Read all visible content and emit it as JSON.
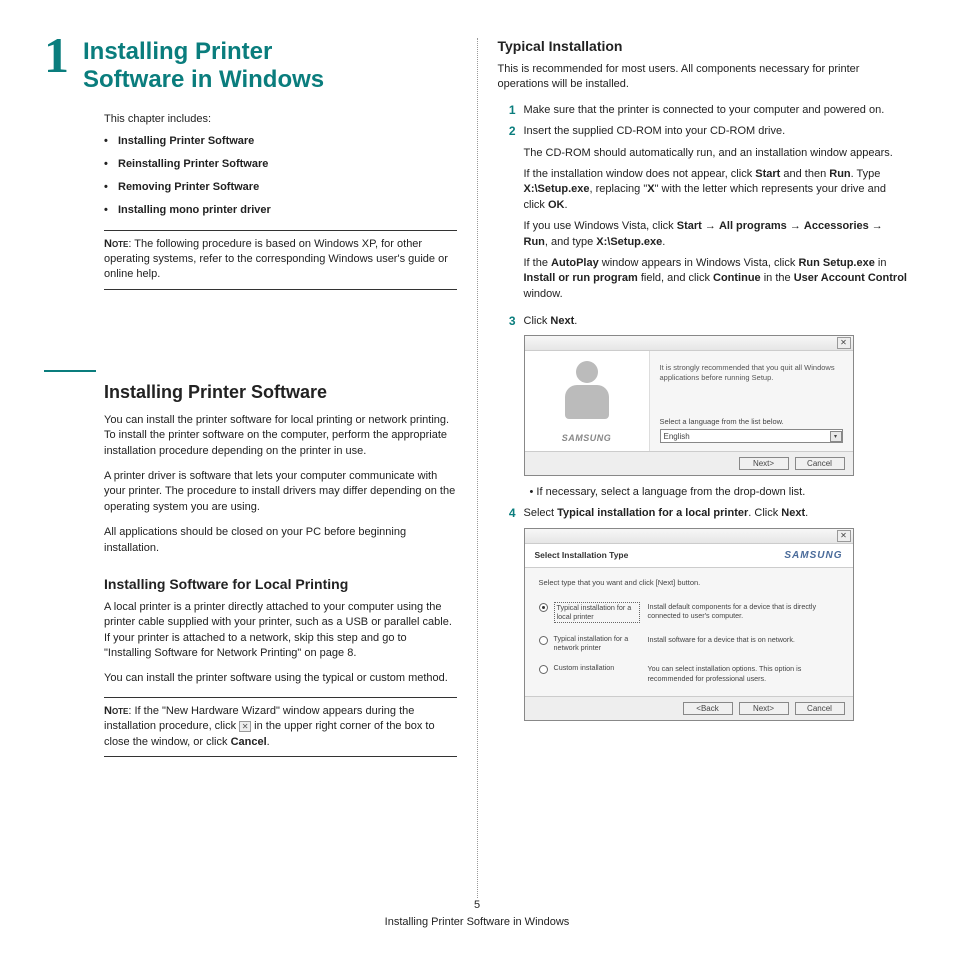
{
  "chapter": {
    "number": "1",
    "title_l1": "Installing Printer",
    "title_l2": "Software in Windows"
  },
  "left": {
    "this_chapter": "This chapter includes:",
    "bullets": [
      "Installing Printer Software",
      "Reinstalling Printer Software",
      "Removing Printer Software",
      "Installing mono printer driver"
    ],
    "note1_label": "Note",
    "note1_text": ": The following procedure is based on Windows XP, for other operating systems, refer to the corresponding Windows user's guide or online help.",
    "h2": "Installing Printer Software",
    "p1": "You can install the printer software for local printing or network printing. To install the printer software on the computer, perform the appropriate installation procedure depending on the printer in use.",
    "p2": "A printer driver is software that lets your computer communicate with your printer. The procedure to install drivers may differ depending on the operating system you are using.",
    "p3": "All applications should be closed on your PC before beginning installation.",
    "h3": "Installing Software for Local Printing",
    "p4": "A local printer is a printer directly attached to your computer using the printer cable supplied with your printer, such as a USB or parallel cable. If your printer is attached to a network, skip this step and go to \"Installing Software for Network Printing\" on page 8.",
    "p5": "You can install the printer software using the typical or custom method.",
    "note2_label": "Note",
    "note2_pre": ": If the \"New Hardware Wizard\" window appears during the installation procedure, click ",
    "note2_post": " in the upper right corner of the box to close the window, or click ",
    "note2_cancel": "Cancel",
    "note2_end": "."
  },
  "right": {
    "h3": "Typical Installation",
    "intro": "This is recommended for most users. All components necessary for printer operations will be installed.",
    "step1": "Make sure that the printer is connected to your computer and powered on.",
    "step2_a": "Insert the supplied CD-ROM into your CD-ROM drive.",
    "step2_b": "The CD-ROM should automatically run, and an installation window appears.",
    "step2_c_pre": "If the installation window does not appear, click ",
    "step2_c_start": "Start",
    "step2_c_mid1": " and then ",
    "step2_c_run": "Run",
    "step2_c_mid2": ". Type ",
    "step2_c_setup": "X:\\Setup.exe",
    "step2_c_mid3": ", replacing \"",
    "step2_c_x": "X",
    "step2_c_mid4": "\" with the letter which represents your drive and click ",
    "step2_c_ok": "OK",
    "step2_c_end": ".",
    "step2_d_pre": "If you use Windows Vista, click ",
    "step2_d_start": "Start",
    "step2_d_arrow": " → ",
    "step2_d_allprog": "All programs",
    "step2_d_acc": "Accessories",
    "step2_d_run": "Run",
    "step2_d_mid": ", and type ",
    "step2_d_setup": "X:\\Setup.exe",
    "step2_d_end": ".",
    "step2_e_pre": "If the ",
    "step2_e_autoplay": "AutoPlay",
    "step2_e_mid1": " window appears in Windows Vista, click ",
    "step2_e_runsetup": "Run Setup.exe",
    "step2_e_mid2": " in ",
    "step2_e_install": "Install or run program",
    "step2_e_mid3": " field, and click ",
    "step2_e_continue": "Continue",
    "step2_e_mid4": " in the ",
    "step2_e_uac": "User Account Control",
    "step2_e_end": " window.",
    "step3_pre": "Click ",
    "step3_next": "Next",
    "step3_end": ".",
    "dlg1": {
      "msg": "It is strongly recommended that you quit all Windows applications before running Setup.",
      "label": "Select a language from the list below.",
      "select_value": "English",
      "btn_next": "Next>",
      "btn_cancel": "Cancel",
      "logo": "SAMSUNG"
    },
    "post_dlg1_bullet": "If necessary, select a language from the drop-down list.",
    "step4_pre": "Select ",
    "step4_bold": "Typical installation for a local printer",
    "step4_mid": ". Click ",
    "step4_next": "Next",
    "step4_end": ".",
    "dlg2": {
      "title": "Select Installation Type",
      "logo": "SAMSUNG",
      "instr": "Select type that you want and click [Next] button.",
      "opt1_label": "Typical installation for a local printer",
      "opt1_desc": "Install default components for a device that is directly connected to user's computer.",
      "opt2_label": "Typical installation for a network printer",
      "opt2_desc": "Install software for a device that is on network.",
      "opt3_label": "Custom installation",
      "opt3_desc": "You can select installation options. This option is recommended for professional users.",
      "btn_back": "<Back",
      "btn_next": "Next>",
      "btn_cancel": "Cancel"
    }
  },
  "footer": {
    "page": "5",
    "title": "Installing Printer Software in Windows"
  }
}
